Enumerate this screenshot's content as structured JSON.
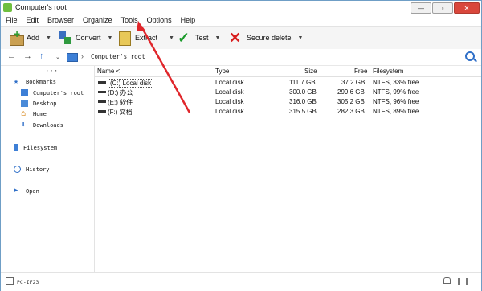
{
  "window": {
    "title": "Computer's root"
  },
  "menu": [
    "File",
    "Edit",
    "Browser",
    "Organize",
    "Tools",
    "Options",
    "Help"
  ],
  "toolbar": {
    "add": "Add",
    "convert": "Convert",
    "extract": "Extract",
    "test": "Test",
    "secure_delete": "Secure delete"
  },
  "breadcrumb": "Computer's root",
  "sidebar": {
    "dots": "···",
    "bookmarks": "Bookmarks",
    "items": [
      "Computer's root",
      "Desktop",
      "Home",
      "Downloads"
    ],
    "filesystem": "Filesystem",
    "history": "History",
    "open": "Open"
  },
  "columns": {
    "name": "Name <",
    "type": "Type",
    "size": "Size",
    "free": "Free",
    "filesystem": "Filesystem"
  },
  "rows": [
    {
      "name": "(C:) Local disk",
      "type": "Local disk",
      "size": "111.7 GB",
      "free": "37.2 GB",
      "fs": "NTFS, 33% free"
    },
    {
      "name": "(D:) 办公",
      "type": "Local disk",
      "size": "300.0 GB",
      "free": "299.6 GB",
      "fs": "NTFS, 99% free"
    },
    {
      "name": "(E:) 软件",
      "type": "Local disk",
      "size": "316.0 GB",
      "free": "305.2 GB",
      "fs": "NTFS, 96% free"
    },
    {
      "name": "(F:) 文档",
      "type": "Local disk",
      "size": "315.5 GB",
      "free": "282.3 GB",
      "fs": "NTFS, 89% free"
    }
  ],
  "status": "PC-IF23",
  "colors": {
    "annotation_arrow": "#e0262b",
    "accent": "#2f6fc8"
  }
}
